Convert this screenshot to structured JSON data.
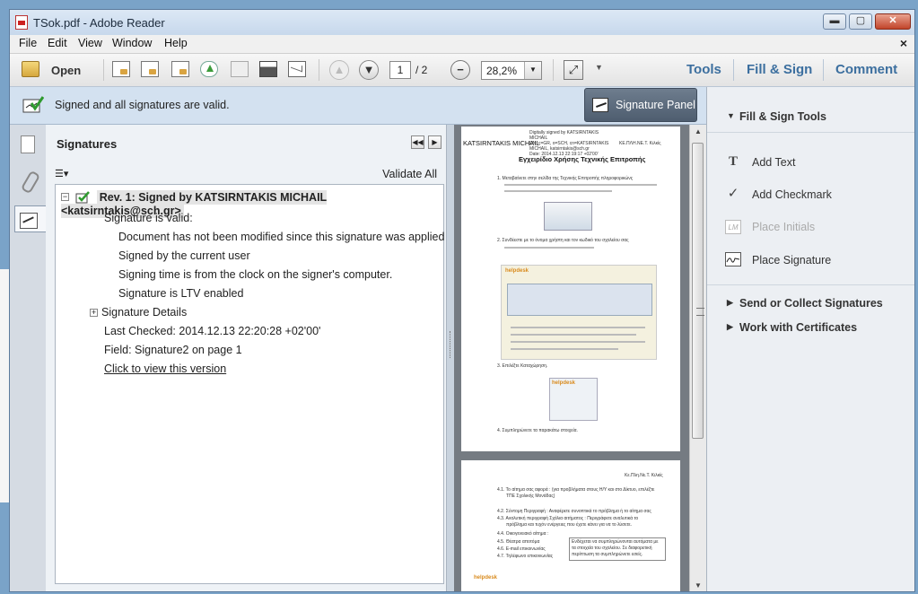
{
  "window": {
    "title": "TSok.pdf - Adobe Reader",
    "controls": {
      "minimize": "▬",
      "maximize": "▢",
      "close": "✕"
    }
  },
  "menubar": {
    "items": [
      "File",
      "Edit",
      "View",
      "Window",
      "Help"
    ],
    "close_doc": "×"
  },
  "toolbar": {
    "open_label": "Open",
    "page_current": "1",
    "page_total": "/ 2",
    "zoom_value": "28,2%",
    "tools_label": "Tools",
    "fill_sign_label": "Fill & Sign",
    "comment_label": "Comment"
  },
  "signature_bar": {
    "message": "Signed and all signatures are valid.",
    "panel_button": "Signature Panel"
  },
  "signatures_panel": {
    "title": "Signatures",
    "validate_all": "Validate All",
    "revision": "Rev. 1: Signed by KATSIRNTAKIS MICHAIL <katsirntakis@sch.gr>",
    "valid_heading": "Signature is valid:",
    "valid_details": [
      "Document has not been modified since this signature was applied",
      "Signed by the current user",
      "Signing time is from the clock on the signer's computer.",
      "Signature is LTV enabled"
    ],
    "details_label": "Signature Details",
    "last_checked": "Last Checked: 2014.12.13 22:20:28 +02'00'",
    "field": "Field: Signature2 on page 1",
    "view_version": "Click to view this version"
  },
  "document": {
    "signer_name": "KATSIRNTAKIS MICHAIL",
    "sig_block": [
      "Digitally signed by KATSIRNTAKIS",
      "MICHAIL",
      "DN: c=GR, o=SCH, cn=KATSIRNTAKIS",
      "MICHAIL, katsirntakis@sch.gr",
      "Date: 2014.12.13 22:19:17 +02'00'"
    ],
    "org_short": "ΚΕ.ΠΛΗ.ΝΕ.Τ. Κιλκίς",
    "title": "Εγχειρίδιο Χρήσης Τεχνικής Επιτροπής",
    "step1": "1.  Μεταβαίνετε στην σελίδα της Τεχνικής Επιτροπής πληροφορικώνς",
    "step2": "2.  Συνδέεστε με το όνομα χρήστη και τον κωδικό του σχολείου σας",
    "step3": "3.  Επιλέξτε Καταχώρηση.",
    "step4": "4.  Συμπληρώνετε τα παρακάτω στοιχεία.",
    "logo_text": "helpdesk",
    "page2_org": "Κε.Πλη.Νε.Τ. Κιλκίς",
    "page2_lines": [
      "4.1.  Το αίτημα σας αφορά : (για προβλήματα στους Η/Υ και στο Δίκτυο, επιλέξτε",
      "ΤΠΕ Σχολικής Μονάδας)",
      "4.2.  Σύντομη Περιγραφή : Αναφέρετε συνοπτικά το πρόβλημα ή το αίτημα σας",
      "4.3.  Αναλυτική περιγραφή Σχόλια αιτήματος : Περιγράφετε αναλυτικά το",
      "πρόβλημα και τυχόν ενέργειες που έχετε κάνει για να το λύσετε.",
      "4.4.  Οικογενειακό αίτημα :",
      "4.5.  Θέατρα αποτόμα",
      "4.6.  E-mail επικοινωνίας",
      "4.7.  Τηλέφωνο επικοινωνίας"
    ],
    "page2_note": [
      "Ενδέχεται να συμπληρώνονται αυτόματα με",
      "τα στοιχεία του σχολείου. Σε διαφορετική",
      "περίπτωση τα συμπληρώνετε εσείς."
    ]
  },
  "right_panel": {
    "fill_sign_tools": "Fill & Sign Tools",
    "items": [
      {
        "label": "Add Text",
        "icon": "T"
      },
      {
        "label": "Add Checkmark",
        "icon": "✓"
      },
      {
        "label": "Place Initials",
        "icon": "LM"
      },
      {
        "label": "Place Signature",
        "icon": "sig"
      }
    ],
    "send_collect": "Send or Collect Signatures",
    "work_certs": "Work with Certificates"
  }
}
